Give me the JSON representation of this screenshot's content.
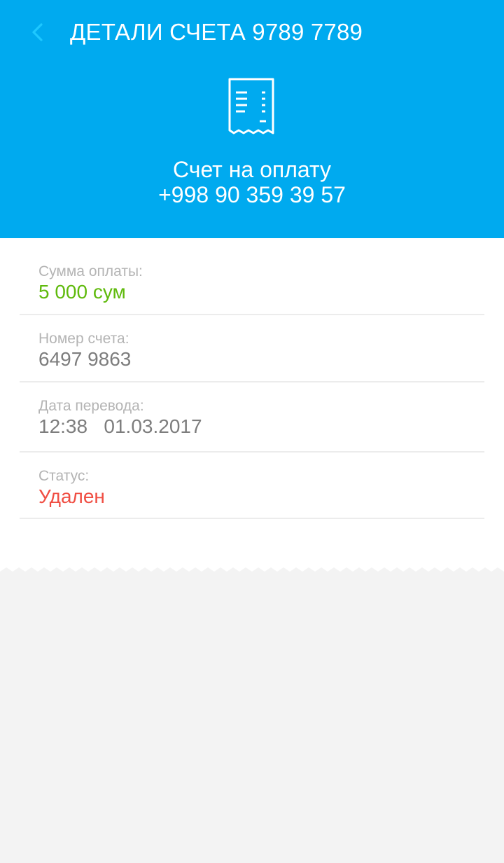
{
  "header": {
    "title": "ДЕТАЛИ СЧЕТА 9789 7789",
    "subtitle_line1": "Счет на оплату",
    "subtitle_line2": "+998 90 359 39 57",
    "back_icon": "chevron-left-icon",
    "receipt_icon": "receipt-icon"
  },
  "details": [
    {
      "label": "Сумма  оплаты:",
      "value": "5 000 сум",
      "color": "#5fba0c"
    },
    {
      "label": "Номер счета:",
      "value": "6497 9863",
      "color": "#7d7d7d"
    },
    {
      "label": "Дата перевода:",
      "value": "12:38   01.03.2017",
      "color": "#7d7d7d"
    },
    {
      "label": "Статус:",
      "value": "Удален",
      "color": "#f04e43"
    }
  ],
  "colors": {
    "header_bg": "#00aaef",
    "back_icon": "#1ec8ff",
    "page_bg": "#f3f3f3",
    "label": "#b4b4b4"
  }
}
